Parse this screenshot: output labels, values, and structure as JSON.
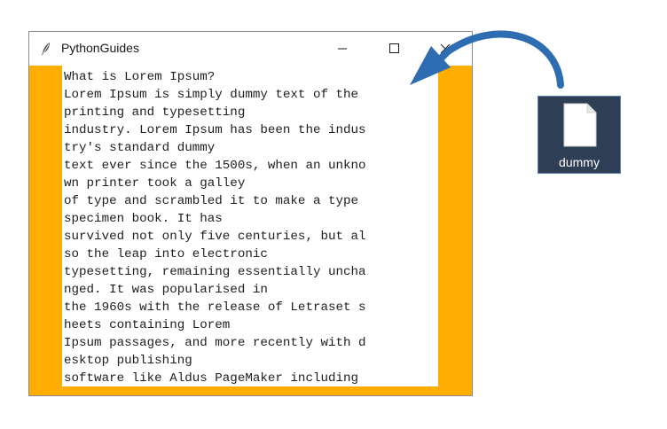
{
  "window": {
    "title": "PythonGuides",
    "icon": "feather-icon",
    "controls": [
      "minimize-icon",
      "maximize-icon",
      "close-icon"
    ]
  },
  "colors": {
    "client_background": "#ffad00",
    "desktop_icon_bg": "#2e3f55",
    "drag_arrow": "#2f6db3"
  },
  "textarea": {
    "lines": [
      "What is Lorem Ipsum?",
      "Lorem Ipsum is simply dummy text of the",
      "printing and typesetting",
      "industry. Lorem Ipsum has been the indus",
      "try's standard dummy",
      "text ever since the 1500s, when an unkno",
      "wn printer took a galley",
      "of type and scrambled it to make a type",
      "specimen book. It has",
      "survived not only five centuries, but al",
      "so the leap into electronic",
      "typesetting, remaining essentially uncha",
      "nged. It was popularised in",
      "the 1960s with the release of Letraset s",
      "heets containing Lorem",
      "Ipsum passages, and more recently with d",
      "esktop publishing",
      "software like Aldus PageMaker including"
    ]
  },
  "desktop": {
    "file_label": "dummy",
    "file_icon": "file-icon"
  }
}
